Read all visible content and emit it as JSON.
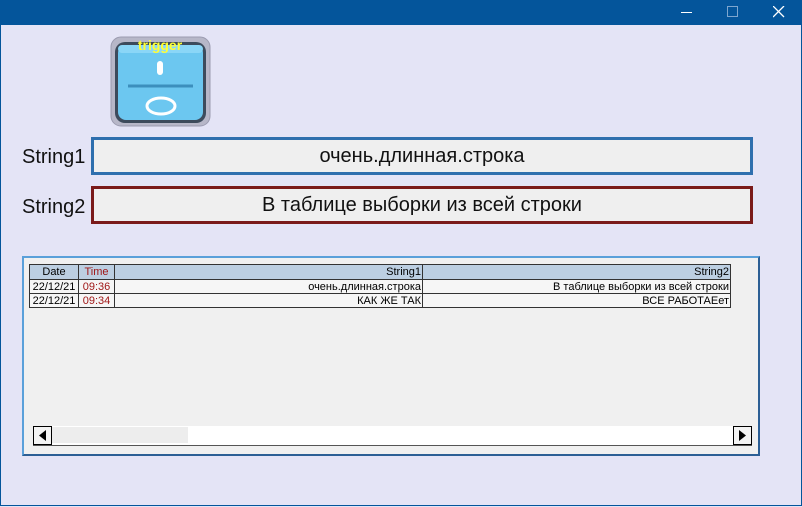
{
  "window": {
    "minimize_icon": "minimize-icon",
    "maximize_icon": "maximize-icon",
    "close_icon": "close-icon"
  },
  "trigger": {
    "label": "trigger",
    "icon": "toggle-switch-icon",
    "colors": {
      "label": "#ffff33",
      "body": "#6cc7f0",
      "frame": "#b7b7c8"
    }
  },
  "form": {
    "string1_label": "String1",
    "string1_value": "очень.длинная.строка",
    "string2_label": "String2",
    "string2_value": "В таблице выборки из всей строки"
  },
  "table": {
    "headers": {
      "date": "Date",
      "time": "Time",
      "string1": "String1",
      "string2": "String2"
    },
    "rows": [
      {
        "date": "22/12/21",
        "time": "09:36",
        "string1": "очень.длинная.строка",
        "string2": "В таблице выборки из всей строки"
      },
      {
        "date": "22/12/21",
        "time": "09:34",
        "string1": "КАК ЖЕ ТАК",
        "string2": "ВСЕ РАБОТАЕет"
      }
    ]
  },
  "colors": {
    "titlebar": "#04559b",
    "background": "#e4e4f6",
    "field1_border": "#2e6fae",
    "field2_border": "#7a1a1a",
    "time_text": "#a01818",
    "header_bg": "#bccfe2"
  }
}
